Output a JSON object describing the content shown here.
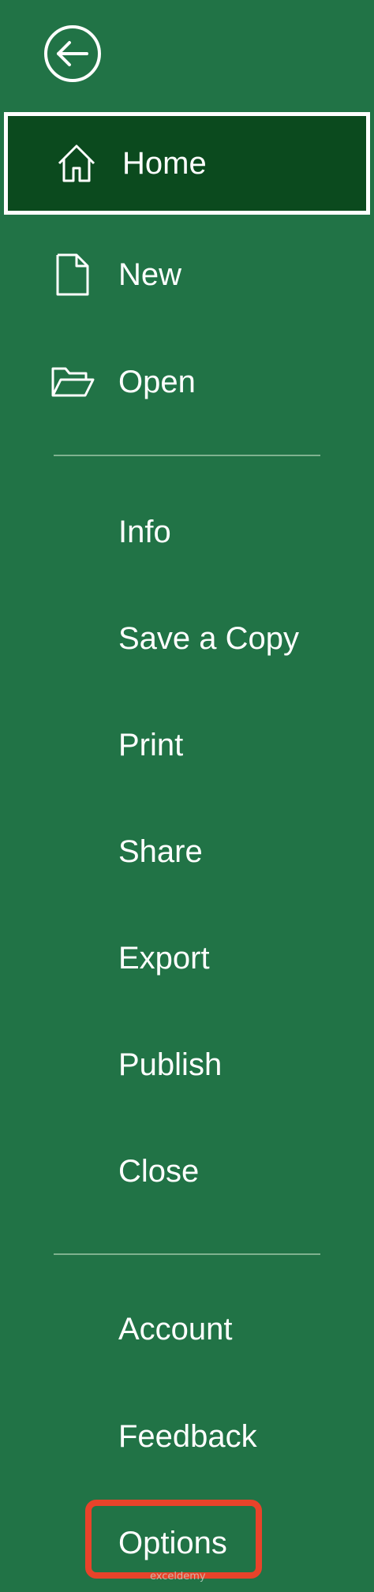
{
  "app": {
    "panel_color": "#217346",
    "selected_color": "#0b4a1e",
    "highlight_color": "#e8432a"
  },
  "back_button": {
    "icon": "arrow-left-circle-icon"
  },
  "nav": {
    "primary": [
      {
        "label": "Home",
        "icon": "home-icon",
        "selected": true
      },
      {
        "label": "New",
        "icon": "new-document-icon",
        "selected": false
      },
      {
        "label": "Open",
        "icon": "open-folder-icon",
        "selected": false
      }
    ],
    "secondary": [
      {
        "label": "Info"
      },
      {
        "label": "Save a Copy"
      },
      {
        "label": "Print"
      },
      {
        "label": "Share"
      },
      {
        "label": "Export"
      },
      {
        "label": "Publish"
      },
      {
        "label": "Close"
      }
    ],
    "footer": [
      {
        "label": "Account"
      },
      {
        "label": "Feedback"
      },
      {
        "label": "Options",
        "highlighted": true
      }
    ]
  },
  "watermark": {
    "text": "exceldemy"
  }
}
